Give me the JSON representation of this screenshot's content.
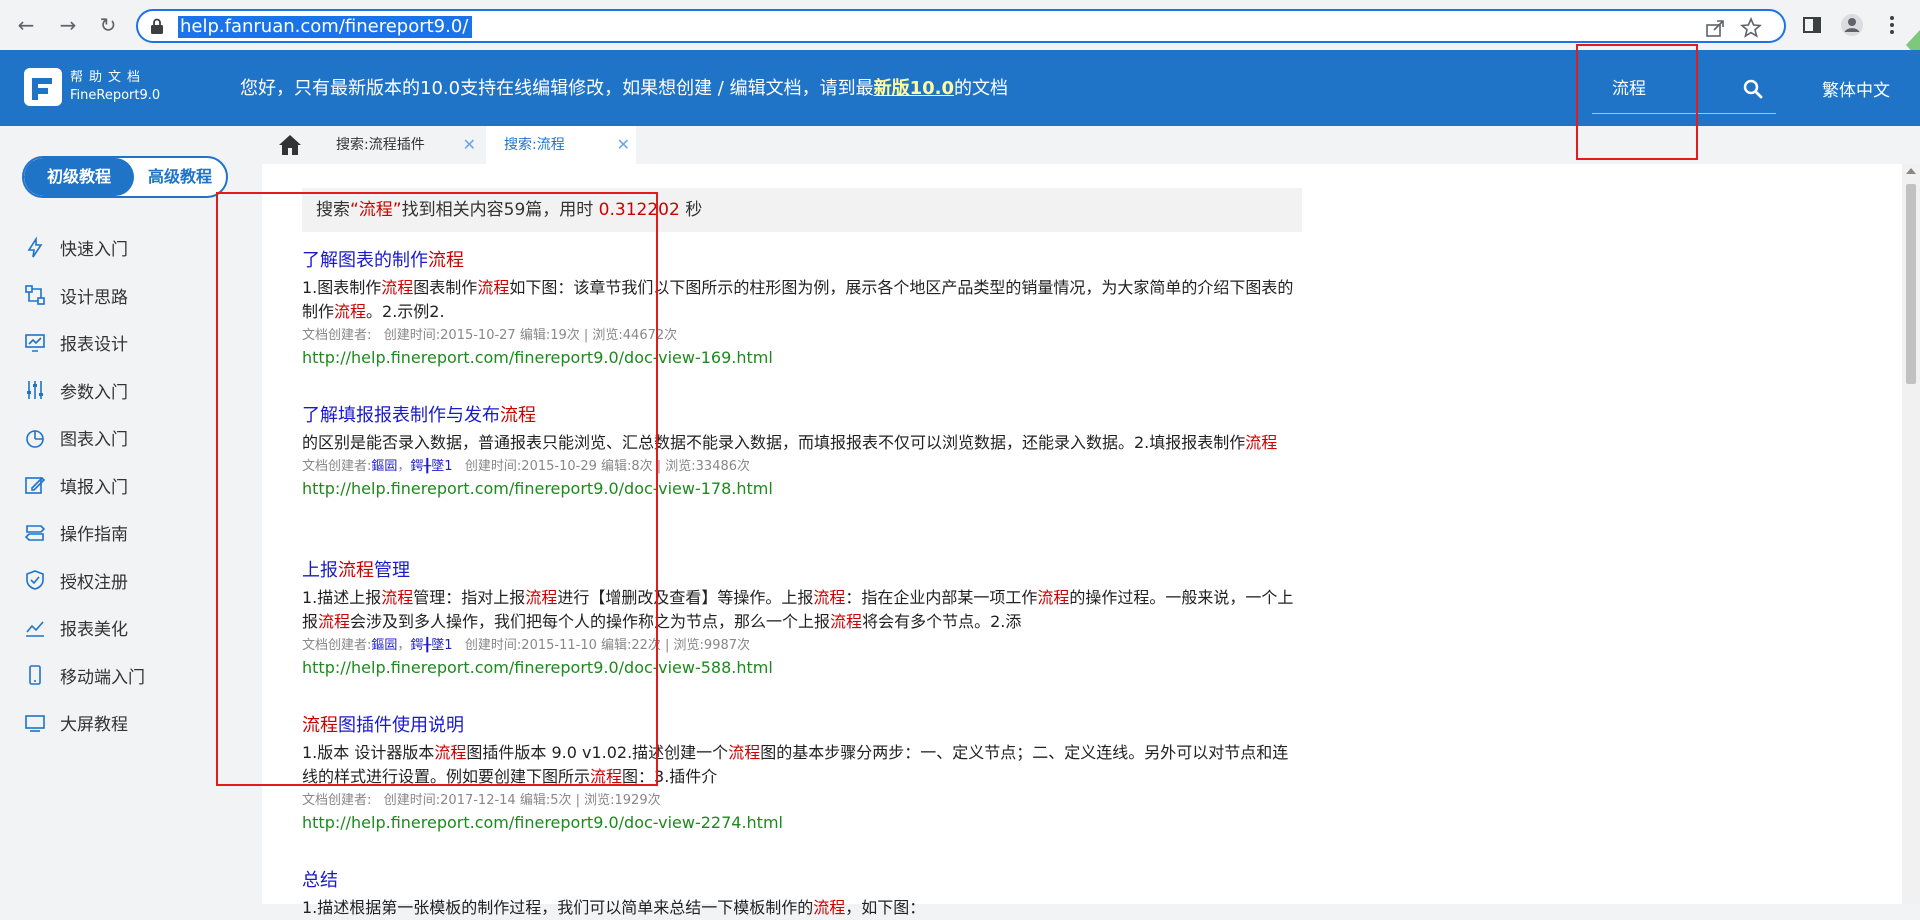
{
  "browser": {
    "url": "help.fanruan.com/finereport9.0/",
    "back": "←",
    "forward": "→",
    "reload": "↻"
  },
  "header": {
    "logo_line1": "帮助文档",
    "logo_line2": "FineReport9.0",
    "notice_before": "您好，只有最新版本的10.0支持在线编辑修改，如果想创建 / 编辑文档，请到最",
    "notice_link": "新版10.0",
    "notice_after": "的文档",
    "search_value": "流程",
    "language": "繁体中文"
  },
  "tabs": [
    {
      "label": "搜索:流程插件",
      "close": "✕"
    },
    {
      "label": "搜索:流程",
      "close": "✕"
    }
  ],
  "sidebar": {
    "toggle_primary": "初级教程",
    "toggle_secondary": "高级教程",
    "items": [
      {
        "label": "快速入门",
        "icon": "lightning-icon"
      },
      {
        "label": "设计思路",
        "icon": "flow-icon"
      },
      {
        "label": "报表设计",
        "icon": "monitor-chart-icon"
      },
      {
        "label": "参数入门",
        "icon": "sliders-icon"
      },
      {
        "label": "图表入门",
        "icon": "pie-chart-icon"
      },
      {
        "label": "填报入门",
        "icon": "edit-icon"
      },
      {
        "label": "操作指南",
        "icon": "signpost-icon"
      },
      {
        "label": "授权注册",
        "icon": "shield-check-icon"
      },
      {
        "label": "报表美化",
        "icon": "line-chart-icon"
      },
      {
        "label": "移动端入门",
        "icon": "mobile-icon"
      },
      {
        "label": "大屏教程",
        "icon": "screen-icon"
      }
    ]
  },
  "summary": {
    "prefix": "搜索",
    "keyword": "“流程”",
    "middle": "找到相关内容59篇，用时",
    "time": "0.312202",
    "suffix": "秒"
  },
  "results": [
    {
      "title_html": "了解图表的制作<span class=\"hl\">流程</span>",
      "desc_html": "1.图表制作<span class=\"hl\">流程</span>图表制作<span class=\"hl\">流程</span>如下图：该章节我们以下图所示的柱形图为例，展示各个地区产品类型的销量情况，为大家简单的介绍下图表的制作<span class=\"hl\">流程</span>。2.示例2.",
      "meta_html": "文档创建者:&nbsp;&nbsp;&nbsp;创建时间:2015-10-27 编辑:19次 | 浏览:44672次",
      "url": "http://help.finereport.com/finereport9.0/doc-view-169.html"
    },
    {
      "title_html": "了解填报报表制作与发布<span class=\"hl\">流程</span>",
      "desc_html": "的区别是能否录入数据，普通报表只能浏览、汇总数据不能录入数据，而填报报表不仅可以浏览数据，还能录入数据。2.填报报表制作<span class=\"hl\">流程</span>",
      "meta_html": "文档创建者:<span class=\"u\">鏂囩</span>，<span class=\"u\">鍔╂墜1</span>&nbsp;&nbsp;&nbsp;创建时间:2015-10-29 编辑:8次 | 浏览:33486次",
      "url": "http://help.finereport.com/finereport9.0/doc-view-178.html"
    },
    {
      "title_html": "上报<span class=\"hl\">流程</span>管理",
      "desc_html": "1.描述上报<span class=\"hl\">流程</span>管理：指对上报<span class=\"hl\">流程</span>进行【增删改及查看】等操作。上报<span class=\"hl\">流程</span>：指在企业内部某一项工作<span class=\"hl\">流程</span>的操作过程。一般来说，一个上报<span class=\"hl\">流程</span>会涉及到多人操作，我们把每个人的操作称之为节点，那么一个上报<span class=\"hl\">流程</span>将会有多个节点。2.添",
      "meta_html": "文档创建者:<span class=\"u\">鏂囩</span>，<span class=\"u\">鍔╂墜1</span>&nbsp;&nbsp;&nbsp;创建时间:2015-11-10 编辑:22次 | 浏览:9987次",
      "url": "http://help.finereport.com/finereport9.0/doc-view-588.html"
    },
    {
      "title_html": "<span class=\"hl\">流程</span>图插件使用说明",
      "desc_html": "1.版本 设计器版本<span class=\"hl\">流程</span>图插件版本 9.0 v1.02.描述创建一个<span class=\"hl\">流程</span>图的基本步骤分两步：一、定义节点；二、定义连线。另外可以对节点和连线的样式进行设置。例如要创建下图所示<span class=\"hl\">流程</span>图：3.插件介",
      "meta_html": "文档创建者:&nbsp;&nbsp;&nbsp;创建时间:2017-12-14 编辑:5次 | 浏览:1929次",
      "url": "http://help.finereport.com/finereport9.0/doc-view-2274.html"
    },
    {
      "title_html": "总结",
      "desc_html": "1.描述根据第一张模板的制作过程，我们可以简单来总结一下模板制作的<span class=\"hl\">流程</span>，如下图：",
      "meta_html": "",
      "url": ""
    }
  ]
}
